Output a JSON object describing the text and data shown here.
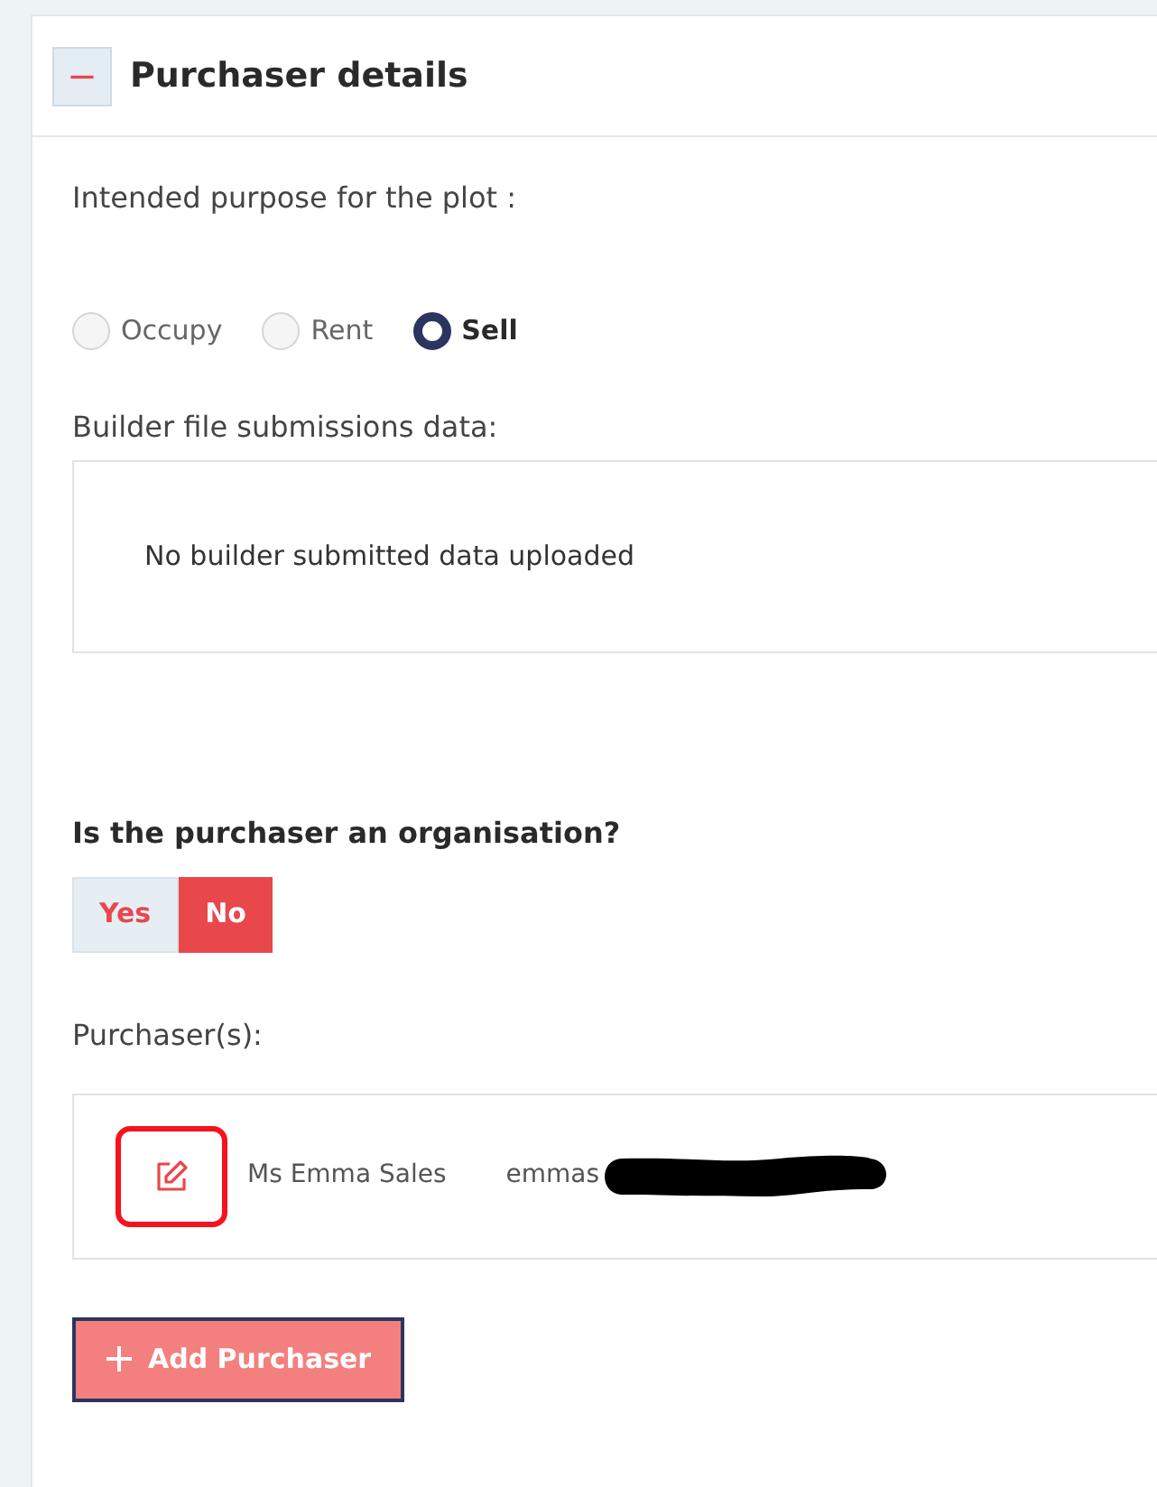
{
  "panel": {
    "title": "Purchaser details",
    "expanded": true,
    "toggle_symbol": "−"
  },
  "purpose": {
    "label": "Intended purpose for the plot :",
    "options": [
      {
        "label": "Occupy",
        "selected": false
      },
      {
        "label": "Rent",
        "selected": false
      },
      {
        "label": "Sell",
        "selected": true
      }
    ]
  },
  "builder_data": {
    "label": "Builder file submissions data:",
    "message": "No builder submitted data uploaded"
  },
  "organisation": {
    "question": "Is the purchaser an organisation?",
    "options": [
      {
        "label": "Yes",
        "selected": false
      },
      {
        "label": "No",
        "selected": true
      }
    ]
  },
  "purchasers": {
    "label": "Purchaser(s):",
    "items": [
      {
        "name": "Ms Emma Sales",
        "email": "emmas",
        "redacted": true
      }
    ]
  },
  "add_button": {
    "label": "Add Purchaser"
  }
}
